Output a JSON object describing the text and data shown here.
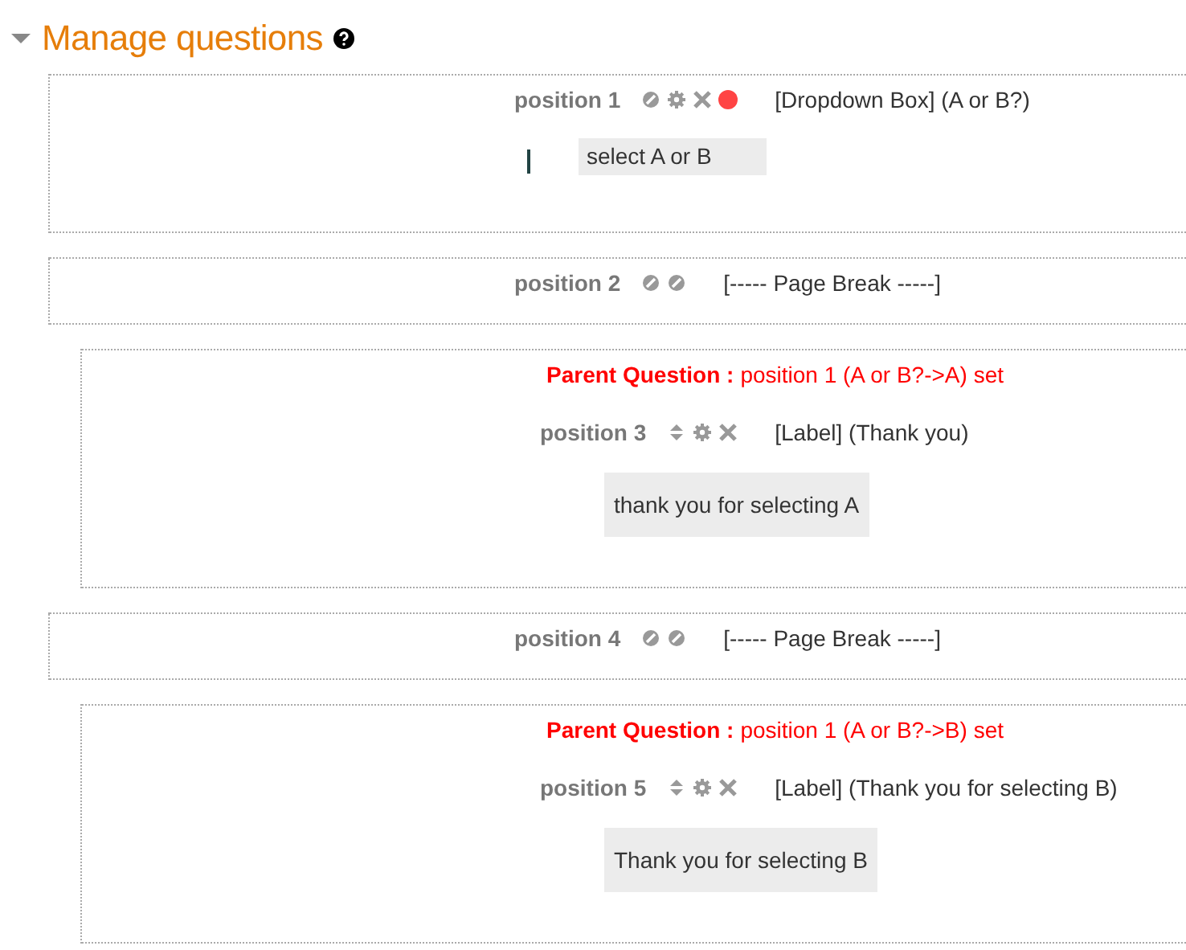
{
  "section": {
    "title": "Manage questions",
    "expanded": true
  },
  "items": [
    {
      "kind": "question",
      "position": "position 1",
      "icons": [
        {
          "kind": "hide"
        },
        {
          "kind": "edit"
        },
        {
          "kind": "delete"
        },
        {
          "kind": "required"
        }
      ],
      "description": "[Dropdown Box] (A or B?)",
      "answer": "select A or B",
      "indent": false
    },
    {
      "kind": "pagebreak",
      "position": "position 2",
      "icons": [
        {
          "kind": "hide"
        },
        {
          "kind": "hide"
        }
      ],
      "description": "[----- Page Break -----]",
      "indent": false
    },
    {
      "kind": "label",
      "parent_label": "Parent Question :",
      "parent_text": "position 1 (A or B?->A) set",
      "position": "position 3",
      "icons": [
        {
          "kind": "move"
        },
        {
          "kind": "edit"
        },
        {
          "kind": "delete"
        }
      ],
      "description": "[Label] (Thank you)",
      "answer": "thank you for selecting A",
      "indent": true
    },
    {
      "kind": "pagebreak",
      "position": "position 4",
      "icons": [
        {
          "kind": "hide"
        },
        {
          "kind": "hide"
        }
      ],
      "description": "[----- Page Break -----]",
      "indent": false
    },
    {
      "kind": "label",
      "parent_label": "Parent Question :",
      "parent_text": "position 1 (A or B?->B) set",
      "position": "position 5",
      "icons": [
        {
          "kind": "move"
        },
        {
          "kind": "edit"
        },
        {
          "kind": "delete"
        }
      ],
      "description": "[Label] (Thank you for selecting B)",
      "answer": "Thank you for selecting B",
      "indent": true
    }
  ]
}
